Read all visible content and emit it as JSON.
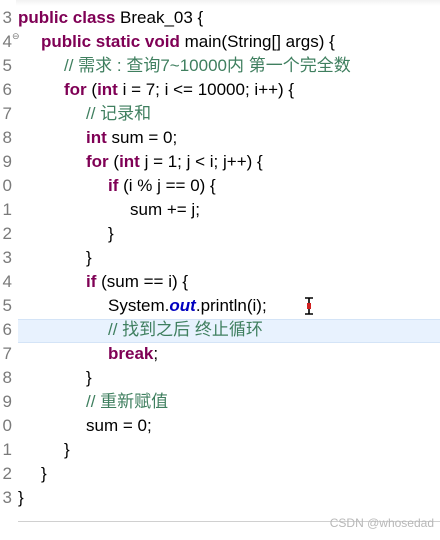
{
  "line_numbers": [
    "3",
    "4",
    "5",
    "6",
    "7",
    "8",
    "9",
    "0",
    "1",
    "2",
    "3",
    "4",
    "5",
    "6",
    "7",
    "8",
    "9",
    "0",
    "1",
    "2",
    "3"
  ],
  "fold_marker": "⊖",
  "code": {
    "l3": {
      "kw1": "public class",
      "rest": " Break_03 {"
    },
    "l4": {
      "kw1": "public static void",
      "rest": " main(String[] args) {"
    },
    "l5": {
      "comment": "// 需求 : 查询7~10000内 第一个完全数"
    },
    "l6": {
      "kw1": "for",
      "mid1": " (",
      "kw2": "int",
      "rest": " i = 7; i <= 10000; i++) {"
    },
    "l7": {
      "comment": "// 记录和"
    },
    "l8": {
      "kw1": "int",
      "rest": " sum = 0;"
    },
    "l9": {
      "kw1": "for",
      "mid1": " (",
      "kw2": "int",
      "rest": " j = 1; j < i; j++) {"
    },
    "l10": {
      "kw1": "if",
      "rest": " (i % j == 0) {"
    },
    "l11": {
      "rest": "sum += j;"
    },
    "l12": {
      "rest": "}"
    },
    "l13": {
      "rest": "}"
    },
    "l14": {
      "kw1": "if",
      "rest": " (sum == i) {"
    },
    "l15": {
      "pre": "System.",
      "field": "out",
      "rest": ".println(i);"
    },
    "l16": {
      "comment": "// 找到之后 终止循环"
    },
    "l17": {
      "kw1": "break",
      "rest": ";"
    },
    "l18": {
      "rest": "}"
    },
    "l19": {
      "comment": "// 重新赋值"
    },
    "l20": {
      "rest": "sum = 0;"
    },
    "l21": {
      "rest": "}"
    },
    "l22": {
      "rest": "}"
    },
    "l23": {
      "rest": "}"
    }
  },
  "watermark": "CSDN @whosedad",
  "colors": {
    "keyword": "#7f0055",
    "comment": "#3f7f5f",
    "field": "#0000c0",
    "current_line": "#e8f2fe"
  }
}
